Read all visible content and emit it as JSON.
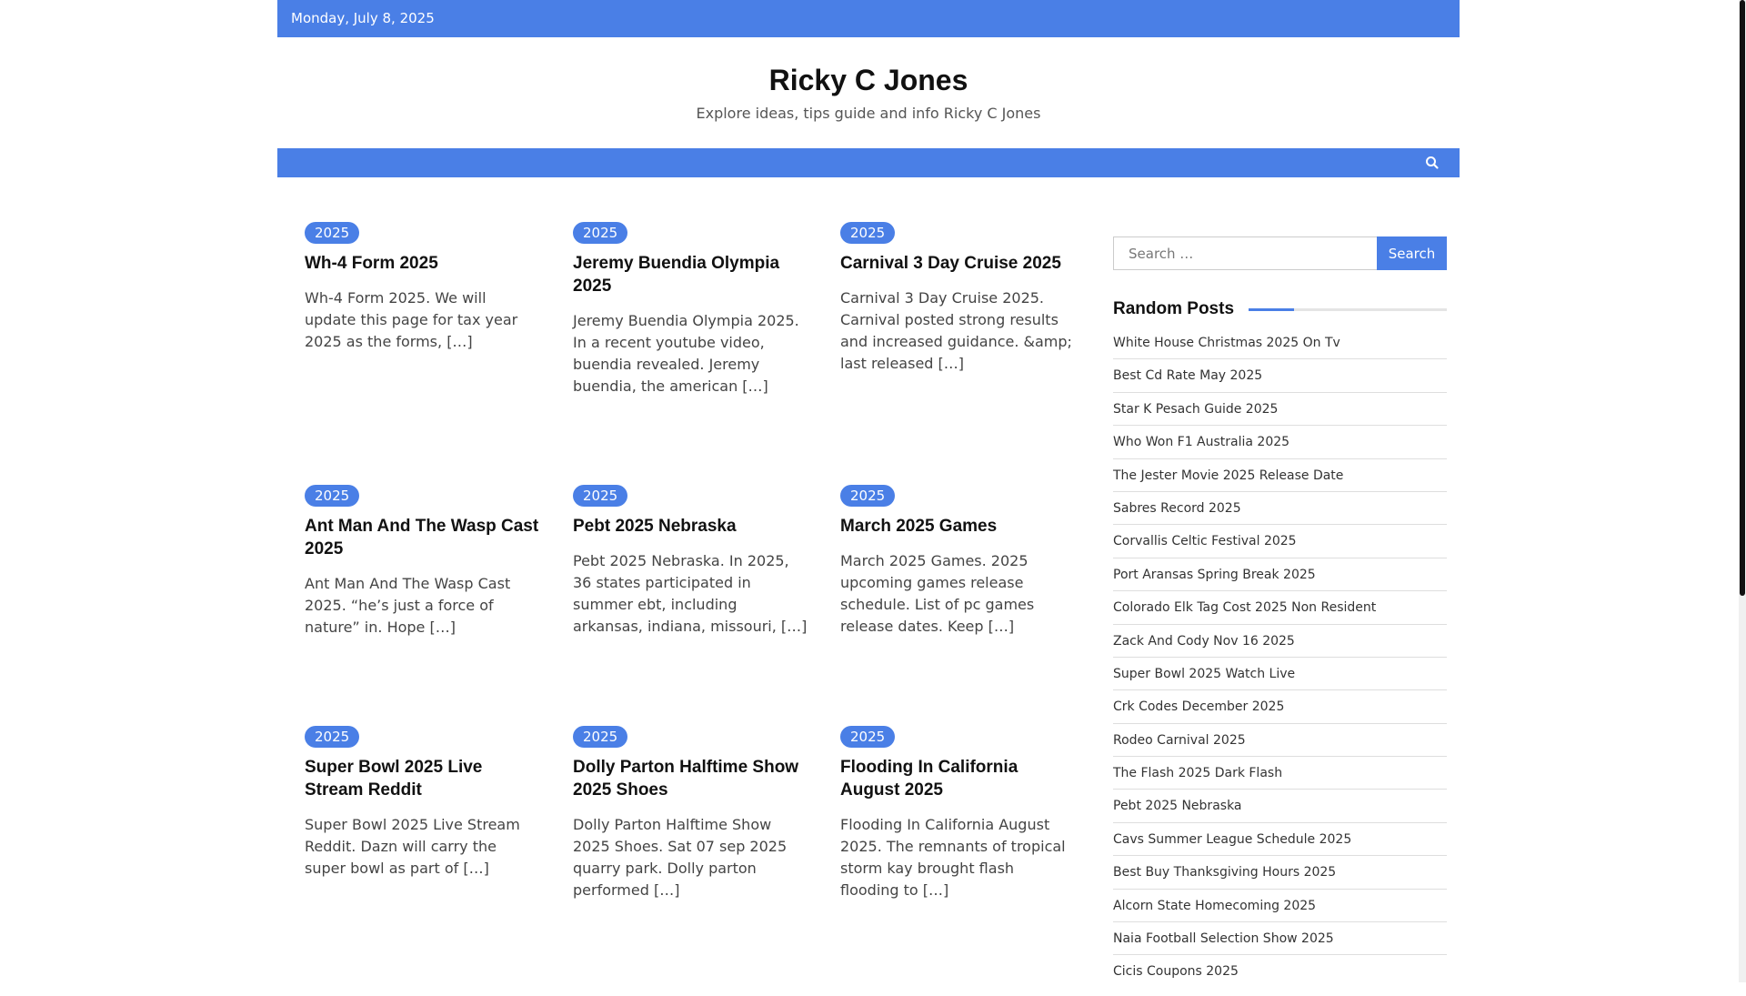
{
  "topbar": {
    "date": "Monday, July 8, 2025"
  },
  "header": {
    "title": "Ricky C Jones",
    "description": "Explore ideas, tips guide and info Ricky C Jones"
  },
  "nav": {
    "search_icon": "search-icon"
  },
  "posts": [
    {
      "category": "2025",
      "title": "Wh-4 Form 2025",
      "excerpt": "Wh-4 Form 2025. We will update this page for tax year 2025 as the forms, […]"
    },
    {
      "category": "2025",
      "title": "Jeremy Buendia Olympia 2025",
      "excerpt": "Jeremy Buendia Olympia 2025. In a recent youtube video, buendia revealed. Jeremy buendia, the american […]"
    },
    {
      "category": "2025",
      "title": "Carnival 3 Day Cruise 2025",
      "excerpt": "Carnival 3 Day Cruise 2025. Carnival posted strong results and increased guidance. &amp; last released […]"
    },
    {
      "category": "2025",
      "title": "Ant Man And The Wasp Cast 2025",
      "excerpt": "Ant Man And The Wasp Cast 2025. “he’s just a force of nature” in. Hope […]"
    },
    {
      "category": "2025",
      "title": "Pebt 2025 Nebraska",
      "excerpt": "Pebt 2025 Nebraska. In 2025, 36 states participated in summer ebt, including arkansas, indiana, missouri, […]"
    },
    {
      "category": "2025",
      "title": "March 2025 Games",
      "excerpt": "March 2025 Games. 2025 upcoming games release schedule. List of pc games release dates. Keep […]"
    },
    {
      "category": "2025",
      "title": "Super Bowl 2025 Live Stream Reddit",
      "excerpt": "Super Bowl 2025 Live Stream Reddit. Dazn will carry the super bowl as part of […]"
    },
    {
      "category": "2025",
      "title": "Dolly Parton Halftime Show 2025 Shoes",
      "excerpt": "Dolly Parton Halftime Show 2025 Shoes. Sat 07 sep 2025 quarry park. Dolly parton performed […]"
    },
    {
      "category": "2025",
      "title": "Flooding In California August 2025",
      "excerpt": "Flooding In California August 2025. The remnants of tropical storm kay brought flash flooding to […]"
    }
  ],
  "sidebar": {
    "search_placeholder": "Search …",
    "search_button": "Search",
    "random_posts_title": "Random Posts",
    "random_posts": [
      "White House Christmas 2025 On Tv",
      "Best Cd Rate May 2025",
      "Star K Pesach Guide 2025",
      "Who Won F1 Australia 2025",
      "The Jester Movie 2025 Release Date",
      "Sabres Record 2025",
      "Corvallis Celtic Festival 2025",
      "Port Aransas Spring Break 2025",
      "Colorado Elk Tag Cost 2025 Non Resident",
      "Zack And Cody Nov 16 2025",
      "Super Bowl 2025 Watch Live",
      "Crk Codes December 2025",
      "Rodeo Carnival 2025",
      "The Flash 2025 Dark Flash",
      "Pebt 2025 Nebraska",
      "Cavs Summer League Schedule 2025",
      "Best Buy Thanksgiving Hours 2025",
      "Alcorn State Homecoming 2025",
      "Naia Football Selection Show 2025",
      "Cicis Coupons 2025"
    ]
  },
  "colors": {
    "accent": "#4a7fe6"
  }
}
